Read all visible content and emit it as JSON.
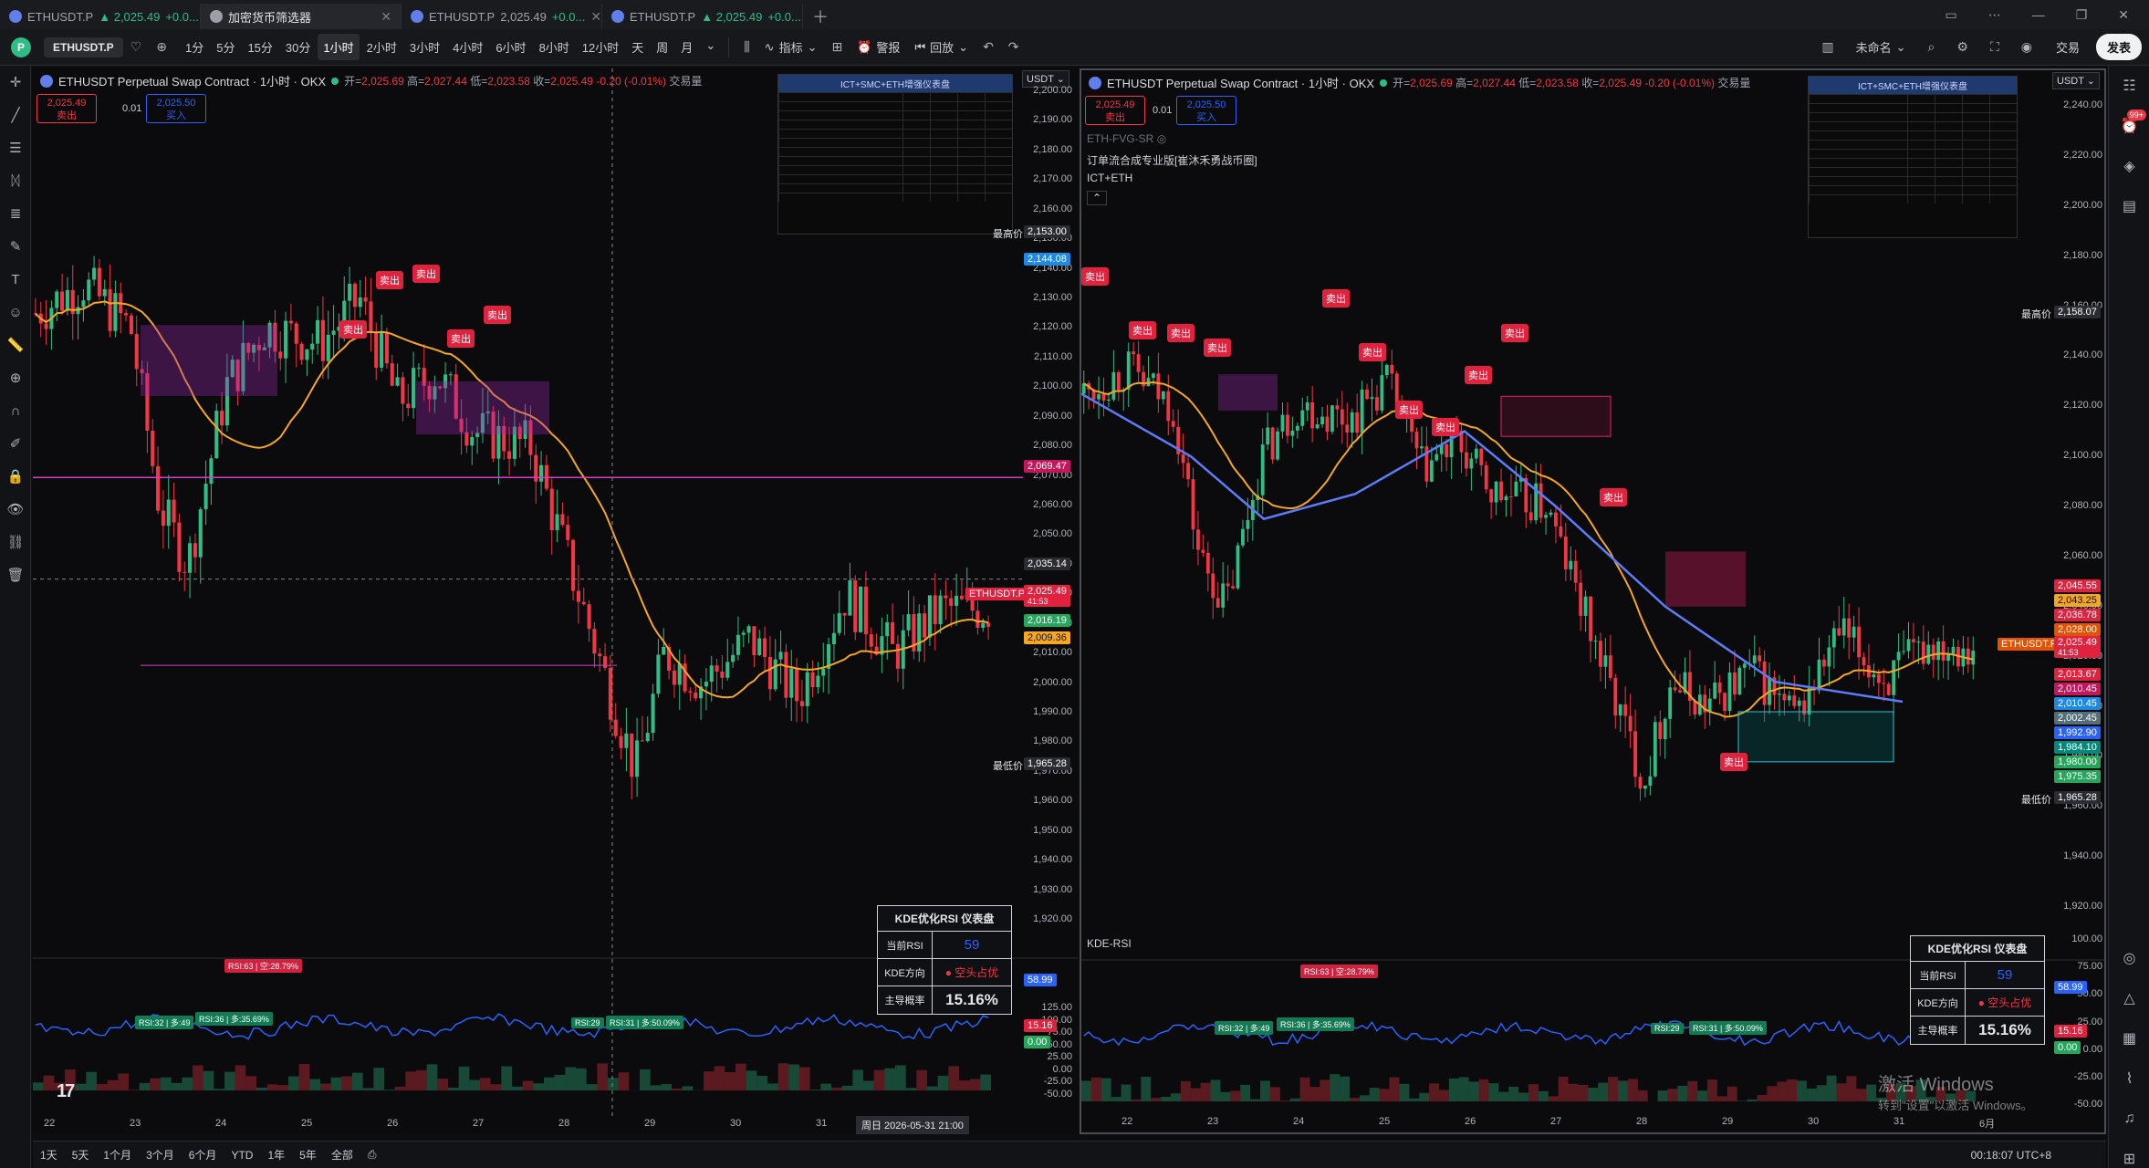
{
  "browser": {
    "tabs": [
      {
        "title": "ETHUSDT.P",
        "price": "▲ 2,025.49",
        "change": "+0.0...",
        "active": false
      },
      {
        "title": "加密货币筛选器",
        "active": true
      },
      {
        "title": "ETHUSDT.P",
        "price": "2,025.49",
        "change": "+0.0...",
        "active": false
      },
      {
        "title": "ETHUSDT.P",
        "price": "▲ 2,025.49",
        "change": "+0.0...",
        "active": false
      }
    ]
  },
  "toolbar": {
    "symbol": "ETHUSDT.P",
    "intervals": [
      "1分",
      "5分",
      "15分",
      "30分",
      "1小时",
      "2小时",
      "3小时",
      "4小时",
      "6小时",
      "8小时",
      "12小时",
      "天",
      "周",
      "月"
    ],
    "active_interval": "1小时",
    "indicators_label": "指标",
    "alert_label": "警报",
    "replay_label": "回放",
    "layout_name": "未命名",
    "trade_label": "交易",
    "publish_label": "发表"
  },
  "left_chart": {
    "title": "ETHUSDT Perpetual Swap Contract · 1小时 · OKX",
    "open": "2,025.69",
    "high": "2,027.44",
    "low": "2,023.58",
    "close": "2,025.49",
    "change": "-0.20 (-0.01%)",
    "volume_label": "交易量",
    "sell_price": "2,025.49",
    "sell_label": "卖出",
    "buy_price": "2,025.50",
    "buy_label": "买入",
    "qty": "0.01",
    "currency": "USDT",
    "dashboard_title": "ICT+SMC+ETH增强仪表盘",
    "y_ticks": [
      "2,200.00",
      "2,190.00",
      "2,180.00",
      "2,170.00",
      "2,160.00",
      "2,150.00",
      "2,140.00",
      "2,130.00",
      "2,120.00",
      "2,110.00",
      "2,100.00",
      "2,090.00",
      "2,080.00",
      "2,070.00",
      "2,060.00",
      "2,050.00",
      "2,040.00",
      "2,030.00",
      "2,020.00",
      "2,010.00",
      "2,000.00",
      "1,990.00",
      "1,980.00",
      "1,970.00",
      "1,960.00",
      "1,950.00",
      "1,940.00",
      "1,930.00",
      "1,920.00"
    ],
    "rsi_ticks": [
      "125.00",
      "100.00",
      "75.00",
      "50.00",
      "25.00",
      "0.00",
      "-25.00",
      "-50.00"
    ],
    "x_ticks": [
      "22",
      "23",
      "24",
      "25",
      "26",
      "27",
      "28",
      "29",
      "30",
      "31",
      "2"
    ],
    "crosshair_date": "周日 2026-05-31   21:00",
    "tags": {
      "high_label": "最高价",
      "high_price": "2,153.00",
      "blue1": "2,144.08",
      "magenta": "2,069.47",
      "crosshair": "2,035.14",
      "symbol_tag": "ETHUSDT.P",
      "last": "2,025.49",
      "countdown": "41:53",
      "green": "2,016.19",
      "orange": "2,009.36",
      "low_label": "最低价",
      "low_price": "1,965.28",
      "rsi_value": "58.99",
      "rsi_red": "15.16",
      "rsi_zero": "0.00"
    },
    "sell_badges": [
      "卖出",
      "卖出",
      "卖出",
      "卖出",
      "卖出"
    ],
    "rsi_labels": [
      "RSI:63 | 空:28.79%",
      "RSI:32 | 多:49",
      "RSI:36 | 多:35.69%",
      "RSI:29",
      "RSI:31 | 多:50.09%"
    ]
  },
  "right_chart": {
    "title": "ETHUSDT Perpetual Swap Contract · 1小时 · OKX",
    "open": "2,025.69",
    "high": "2,027.44",
    "low": "2,023.58",
    "close": "2,025.49",
    "change": "-0.20 (-0.01%)",
    "volume_label": "交易量",
    "sell_price": "2,025.49",
    "sell_label": "卖出",
    "buy_price": "2,025.50",
    "buy_label": "买入",
    "qty": "0.01",
    "currency": "USDT",
    "sub1": "ETH-FVG-SR",
    "sub2": "订单流合成专业版[崔沐禾勇战币圈]",
    "sub3": "ICT+ETH",
    "dashboard_title": "ICT+SMC+ETH增强仪表盘",
    "rsi_pane_label": "KDE-RSI",
    "y_ticks": [
      "2,240.00",
      "2,220.00",
      "2,200.00",
      "2,180.00",
      "2,160.00",
      "2,140.00",
      "2,120.00",
      "2,100.00",
      "2,080.00",
      "2,060.00",
      "2,040.00",
      "2,020.00",
      "2,000.00",
      "1,980.00",
      "1,960.00",
      "1,940.00",
      "1,920.00"
    ],
    "rsi_ticks": [
      "100.00",
      "75.00",
      "50.00",
      "25.00",
      "0.00",
      "-25.00",
      "-50.00"
    ],
    "x_ticks": [
      "22",
      "23",
      "24",
      "25",
      "26",
      "27",
      "28",
      "29",
      "30",
      "31",
      "6月"
    ],
    "tags": {
      "high_label": "最高价",
      "high_price": "2,158.07",
      "t1": "2,045.55",
      "t2": "2,043.25",
      "t3": "2,036.78",
      "t4": "2,028.00",
      "symbol_tag": "ETHUSDT.P",
      "last": "2,025.49",
      "countdown": "41:53",
      "t5": "2,013.67",
      "t6": "2,010.45",
      "t7": "2,010.45",
      "t8": "2,002.45",
      "t9": "1,992.90",
      "t10": "1,984.10",
      "t11": "1,980.00",
      "t12": "1,975.35",
      "low_label": "最低价",
      "low_price": "1,965.28",
      "rsi_value": "58.99",
      "rsi_red": "15.16",
      "rsi_zero": "0.00"
    },
    "sell_badges": [
      "卖出",
      "卖出",
      "卖出",
      "卖出",
      "卖出",
      "卖出",
      "卖出",
      "卖出",
      "卖出",
      "卖出",
      "卖出",
      "卖出"
    ],
    "rsi_labels": [
      "RSI:63 | 空:28.79%",
      "RSI:32 | 多:49",
      "RSI:36 | 多:35.69%",
      "RSI:29",
      "RSI:31 | 多:50.09%"
    ]
  },
  "kde_panel": {
    "title": "KDE优化RSI 仪表盘",
    "rsi_label": "当前RSI",
    "rsi_value": "59",
    "dir_label": "KDE方向",
    "dir_value": "空头占优",
    "prob_label": "主导概率",
    "prob_value": "15.16%"
  },
  "bottom": {
    "ranges": [
      "1天",
      "5天",
      "1个月",
      "3个月",
      "6个月",
      "YTD",
      "1年",
      "5年",
      "全部"
    ],
    "clock": "00:18:07 UTC+8"
  },
  "watermark": {
    "line1": "激活 Windows",
    "line2": "转到\"设置\"以激活 Windows。"
  },
  "right_sidebar": {
    "badge": "99+"
  },
  "colors": {
    "up": "#2ebd85",
    "down": "#f23645",
    "accent": "#2962ff",
    "ma_orange": "#f5a623",
    "magenta": "#d63cc6"
  }
}
